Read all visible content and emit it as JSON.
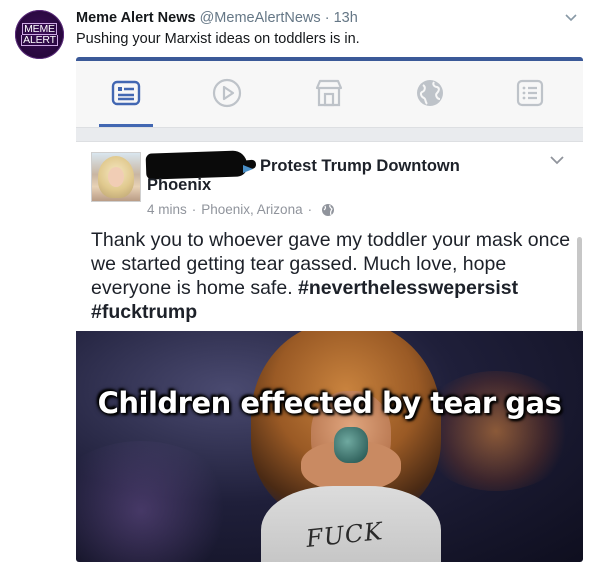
{
  "tweet": {
    "avatar_line1": "MEME",
    "avatar_line2": "ALERT",
    "author_name": "Meme Alert News",
    "author_handle": "@MemeAlertNews",
    "separator": "·",
    "time": "13h",
    "text": "Pushing your Marxist ideas on toddlers is in."
  },
  "screenshot": {
    "nav_icons": [
      "news-feed-icon",
      "watch-play-icon",
      "marketplace-icon",
      "globe-icon",
      "menu-list-icon"
    ],
    "post": {
      "event_name": "Protest Trump Downtown",
      "event_name_cont": "Phoenix",
      "time": "4 mins",
      "dot": "·",
      "location": "Phoenix, Arizona",
      "body_plain": "Thank you to whoever gave my toddler your mask once we started getting tear gassed. Much love, hope everyone is home safe.",
      "hashtag1": "#neverthelesswepersist",
      "hashtag2": "#fucktrump",
      "photo_caption": "Children effected by tear gas",
      "shirt_text": "FUCK"
    }
  },
  "colors": {
    "facebook_blue": "#4267b2",
    "avatar_purple": "#2a0840",
    "muted_gray": "#657786"
  }
}
